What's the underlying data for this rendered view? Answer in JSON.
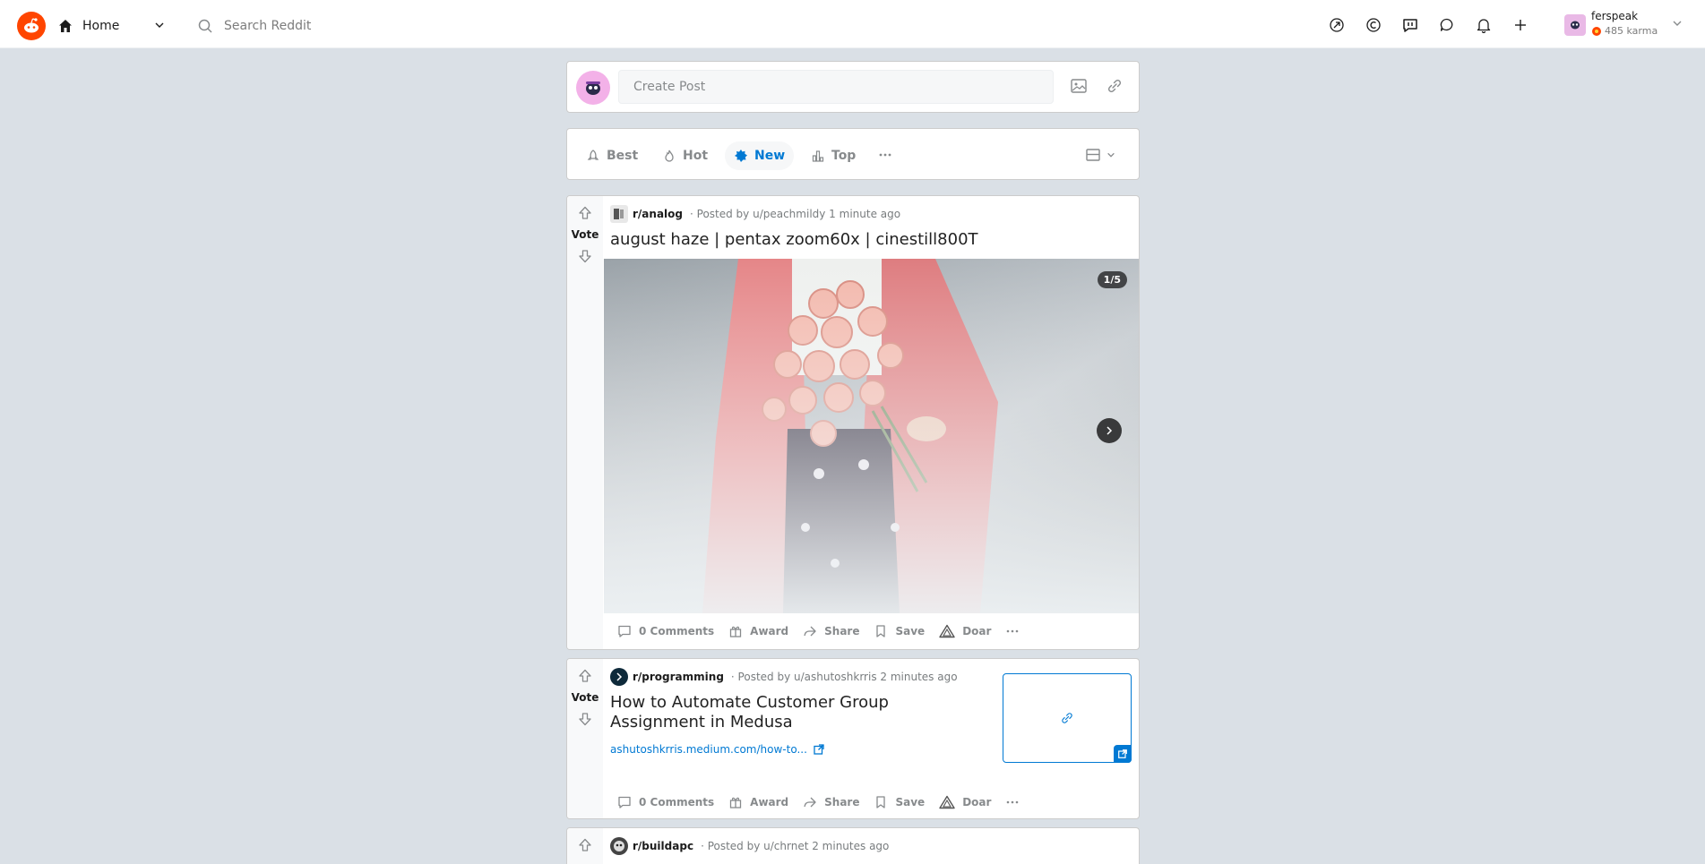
{
  "header": {
    "home_label": "Home",
    "search_placeholder": "Search Reddit",
    "icons": [
      "popular-icon",
      "coins-icon",
      "chat-bubble-icon",
      "messages-icon",
      "notifications-icon",
      "plus-icon"
    ],
    "user": {
      "name": "ferspeak",
      "karma": "485 karma"
    }
  },
  "create_post": {
    "placeholder": "Create Post"
  },
  "sort": {
    "options": [
      {
        "label": "Best",
        "active": false
      },
      {
        "label": "Hot",
        "active": false
      },
      {
        "label": "New",
        "active": true
      },
      {
        "label": "Top",
        "active": false
      }
    ]
  },
  "posts": [
    {
      "subreddit": "r/analog",
      "posted_by": "· Posted by u/peachmildy 1 minute ago",
      "vote_label": "Vote",
      "title": "august haze | pentax zoom60x | cinestill800T",
      "gallery_counter": "1/5",
      "actions": {
        "comments": "0 Comments",
        "award": "Award",
        "share": "Share",
        "save": "Save",
        "doar": "Doar"
      }
    },
    {
      "subreddit": "r/programming",
      "posted_by": "· Posted by u/ashutoshkrris 2 minutes ago",
      "vote_label": "Vote",
      "title": "How to Automate Customer Group Assignment in Medusa",
      "link": "ashutoshkrris.medium.com/how-to...",
      "actions": {
        "comments": "0 Comments",
        "award": "Award",
        "share": "Share",
        "save": "Save",
        "doar": "Doar"
      }
    },
    {
      "subreddit": "r/buildapc",
      "posted_by": "· Posted by u/chrnet 2 minutes ago"
    }
  ],
  "colors": {
    "accent": "#0079d3",
    "brand": "#ff4500",
    "background": "#dae0e6"
  }
}
